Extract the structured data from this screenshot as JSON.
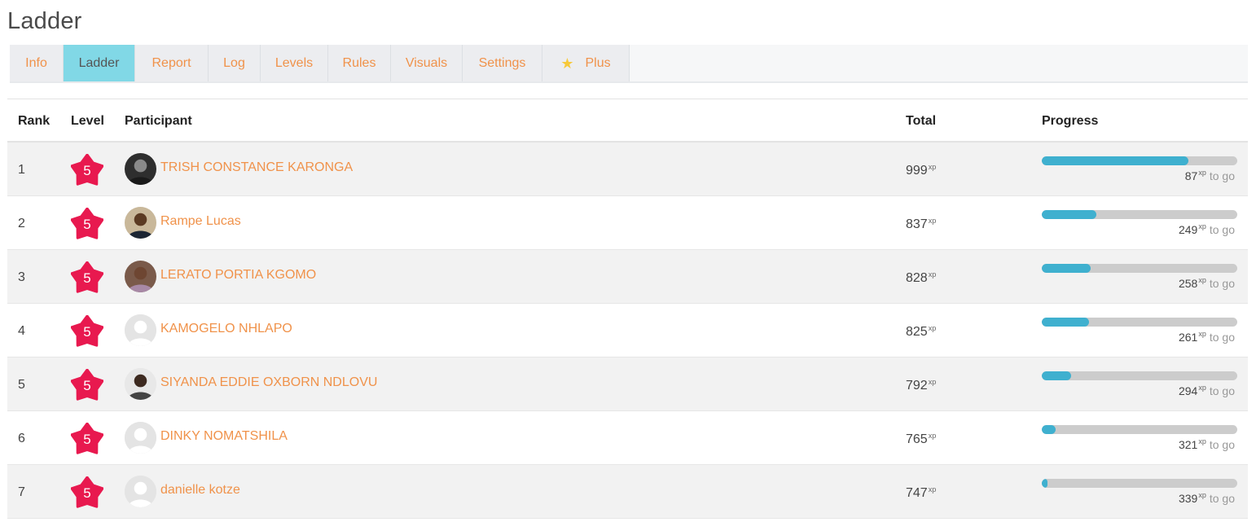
{
  "page": {
    "title": "Ladder"
  },
  "tabs": [
    {
      "label": "Info",
      "active": false,
      "icon": ""
    },
    {
      "label": "Ladder",
      "active": true,
      "icon": ""
    },
    {
      "label": "Report",
      "active": false,
      "icon": ""
    },
    {
      "label": "Log",
      "active": false,
      "icon": ""
    },
    {
      "label": "Levels",
      "active": false,
      "icon": ""
    },
    {
      "label": "Rules",
      "active": false,
      "icon": ""
    },
    {
      "label": "Visuals",
      "active": false,
      "icon": ""
    },
    {
      "label": "Settings",
      "active": false,
      "icon": ""
    },
    {
      "label": "Plus",
      "active": false,
      "icon": "star-icon"
    }
  ],
  "table": {
    "headers": {
      "rank": "Rank",
      "level": "Level",
      "participant": "Participant",
      "total": "Total",
      "progress": "Progress"
    },
    "xp_unit": "xp",
    "to_go_label": "to go",
    "rows": [
      {
        "rank": "1",
        "level": "5",
        "name": "TRISH CONSTANCE KARONGA",
        "total": "999",
        "to_go": "87",
        "progress": 0.75,
        "avatar": "photo-dark"
      },
      {
        "rank": "2",
        "level": "5",
        "name": "Rampe Lucas",
        "total": "837",
        "to_go": "249",
        "progress": 0.28,
        "avatar": "photo-man"
      },
      {
        "rank": "3",
        "level": "5",
        "name": "LERATO PORTIA KGOMO",
        "total": "828",
        "to_go": "258",
        "progress": 0.25,
        "avatar": "photo-woman"
      },
      {
        "rank": "4",
        "level": "5",
        "name": "KAMOGELO NHLAPO",
        "total": "825",
        "to_go": "261",
        "progress": 0.24,
        "avatar": "default"
      },
      {
        "rank": "5",
        "level": "5",
        "name": "SIYANDA EDDIE OXBORN NDLOVU",
        "total": "792",
        "to_go": "294",
        "progress": 0.15,
        "avatar": "photo-suit"
      },
      {
        "rank": "6",
        "level": "5",
        "name": "DINKY NOMATSHILA",
        "total": "765",
        "to_go": "321",
        "progress": 0.07,
        "avatar": "default"
      },
      {
        "rank": "7",
        "level": "5",
        "name": "danielle kotze",
        "total": "747",
        "to_go": "339",
        "progress": 0.03,
        "avatar": "default"
      }
    ]
  },
  "colors": {
    "accent_orange": "#f0924a",
    "active_tab": "#81d8e6",
    "level_badge": "#e8194f",
    "progress_fill": "#3fb0cf",
    "progress_track": "#cccccc"
  }
}
